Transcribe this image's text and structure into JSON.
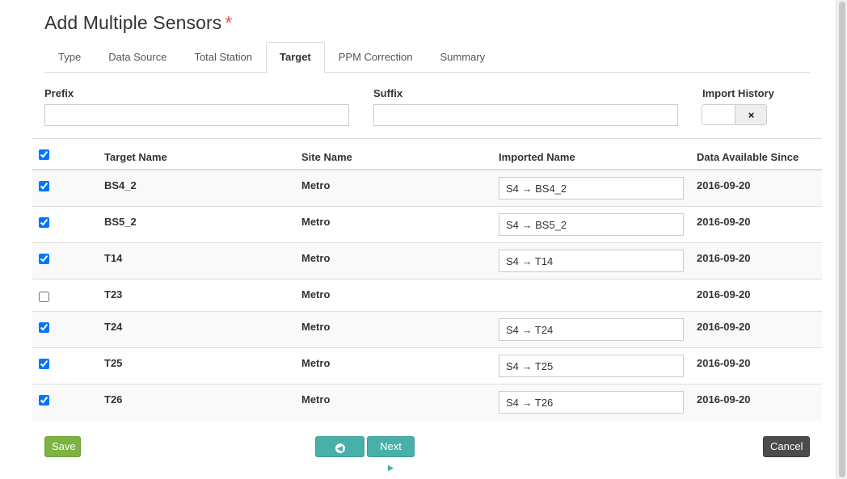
{
  "title": "Add Multiple Sensors",
  "required_marker": "*",
  "tabs": [
    {
      "label": "Type"
    },
    {
      "label": "Data Source"
    },
    {
      "label": "Total Station"
    },
    {
      "label": "Target",
      "active": true
    },
    {
      "label": "PPM Correction"
    },
    {
      "label": "Summary"
    }
  ],
  "form": {
    "prefix": {
      "label": "Prefix",
      "value": ""
    },
    "suffix": {
      "label": "Suffix",
      "value": ""
    },
    "import_history": {
      "label": "Import History",
      "off_symbol": "×",
      "state": "off"
    }
  },
  "table": {
    "columns": [
      "Target Name",
      "Site Name",
      "Imported Name",
      "Data Available Since"
    ],
    "select_all_checked": true,
    "rows": [
      {
        "checked": true,
        "target": "BS4_2",
        "site": "Metro",
        "imported": "S4 → BS4_2",
        "since": "2016-09-20"
      },
      {
        "checked": true,
        "target": "BS5_2",
        "site": "Metro",
        "imported": "S4 → BS5_2",
        "since": "2016-09-20"
      },
      {
        "checked": true,
        "target": "T14",
        "site": "Metro",
        "imported": "S4 → T14",
        "since": "2016-09-20"
      },
      {
        "checked": false,
        "target": "T23",
        "site": "Metro",
        "imported": "",
        "since": "2016-09-20"
      },
      {
        "checked": true,
        "target": "T24",
        "site": "Metro",
        "imported": "S4 → T24",
        "since": "2016-09-20"
      },
      {
        "checked": true,
        "target": "T25",
        "site": "Metro",
        "imported": "S4 → T25",
        "since": "2016-09-20"
      },
      {
        "checked": true,
        "target": "T26",
        "site": "Metro",
        "imported": "S4 → T26",
        "since": "2016-09-20"
      }
    ]
  },
  "buttons": {
    "save": "Save",
    "back": "Back",
    "next": "Next",
    "cancel": "Cancel"
  },
  "icons": {
    "back": "arrow-circle-left-icon",
    "next": "arrow-circle-right-icon"
  },
  "colors": {
    "required": "#d9534f",
    "save": "#7cb342",
    "nav": "#48b0a8",
    "cancel": "#4c4c4c"
  }
}
